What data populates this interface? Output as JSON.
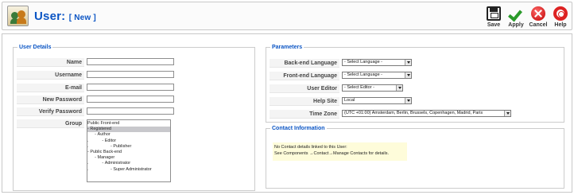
{
  "header": {
    "title": "User:",
    "subtitle": "[ New ]",
    "toolbar": [
      {
        "label": "Save",
        "icon": "save-icon"
      },
      {
        "label": "Apply",
        "icon": "apply-icon"
      },
      {
        "label": "Cancel",
        "icon": "cancel-icon"
      },
      {
        "label": "Help",
        "icon": "help-icon"
      }
    ]
  },
  "user_details": {
    "legend": "User Details",
    "fields": [
      {
        "label": "Name",
        "value": ""
      },
      {
        "label": "Username",
        "value": ""
      },
      {
        "label": "E-mail",
        "value": ""
      },
      {
        "label": "New Password",
        "value": ""
      },
      {
        "label": "Verify Password",
        "value": ""
      }
    ],
    "group_label": "Group",
    "groups": [
      {
        "text": "Public Front-end",
        "selected": false
      },
      {
        "text": "- Registered",
        "selected": true
      },
      {
        "text": "      - Author",
        "selected": false
      },
      {
        "text": ".           - Editor",
        "selected": false
      },
      {
        "text": ".                  - Publisher",
        "selected": false
      },
      {
        "text": "- Public Back-end",
        "selected": false
      },
      {
        "text": "      - Manager",
        "selected": false
      },
      {
        "text": ".           - Administrator",
        "selected": false
      },
      {
        "text": ".                  - Super Administrator",
        "selected": false
      }
    ]
  },
  "parameters": {
    "legend": "Parameters",
    "rows": [
      {
        "label": "Back-end Language",
        "value": "- Select Language -"
      },
      {
        "label": "Front-end Language",
        "value": "- Select Language -"
      },
      {
        "label": "User Editor",
        "value": "- Select Editor -"
      },
      {
        "label": "Help Site",
        "value": "Local"
      },
      {
        "label": "Time Zone",
        "value": "(UTC +01:00) Amsterdam, Berlin, Brussels, Copenhagen, Madrid, Paris"
      }
    ]
  },
  "contact": {
    "legend": "Contact Information",
    "line1": "No Contact details linked to this User:",
    "line2": "See Components →Contact→Manage Contacts for details."
  }
}
